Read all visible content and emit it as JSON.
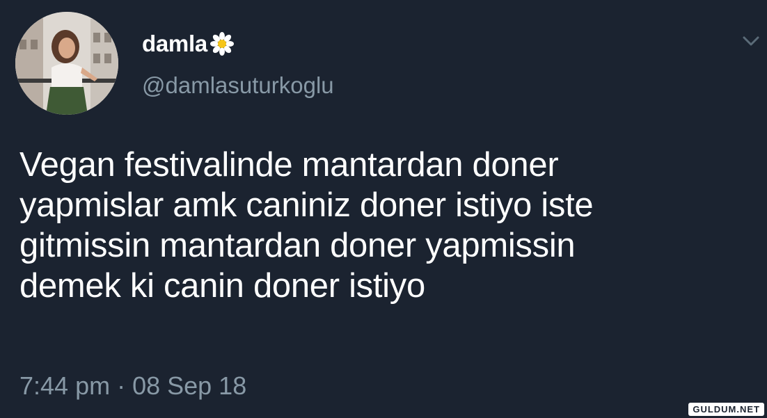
{
  "user": {
    "display_name": "damla",
    "handle": "@damlasuturkoglu"
  },
  "tweet": {
    "text": "Vegan festivalinde mantardan doner\nyapmislar amk caniniz doner istiyo iste\ngitmissin mantardan doner yapmissin\ndemek ki canin doner istiyo",
    "timestamp": "7:44 pm · 08 Sep 18"
  },
  "watermark": "GULDUM.NET",
  "colors": {
    "background": "#1b2330",
    "text": "#ffffff",
    "secondary": "#8899a6"
  },
  "icons": {
    "name_emoji": "daisy-icon",
    "menu": "chevron-down-icon"
  }
}
